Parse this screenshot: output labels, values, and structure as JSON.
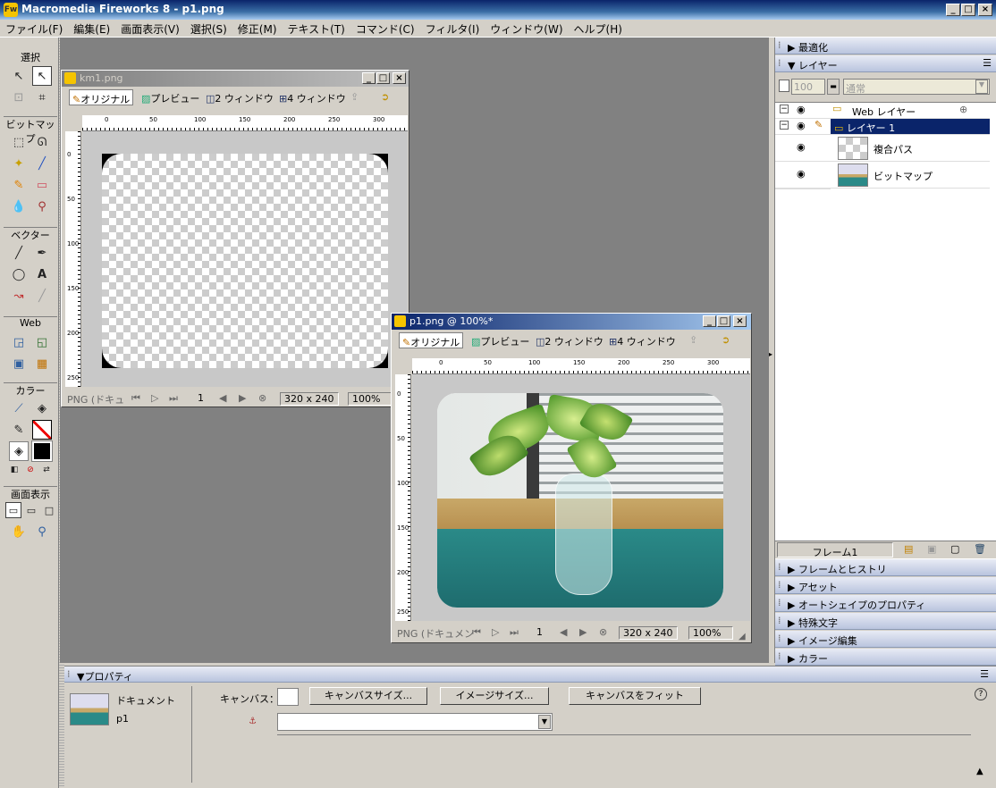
{
  "window": {
    "title": "Macromedia Fireworks 8 - p1.png"
  },
  "menu": [
    "ファイル(F)",
    "編集(E)",
    "画面表示(V)",
    "選択(S)",
    "修正(M)",
    "テキスト(T)",
    "コマンド(C)",
    "フィルタ(I)",
    "ウィンドウ(W)",
    "ヘルプ(H)"
  ],
  "tools": {
    "sections": [
      "選択",
      "ビットマップ",
      "ベクター",
      "Web",
      "カラー",
      "画面表示"
    ]
  },
  "doc1": {
    "title": "km1.png",
    "tabs": [
      "オリジナル",
      "プレビュー",
      "2 ウィンドウ",
      "4 ウィンドウ"
    ],
    "ruler_h": [
      "0",
      "50",
      "100",
      "150",
      "200",
      "250",
      "300"
    ],
    "ruler_v": [
      "0",
      "50",
      "100",
      "150",
      "200",
      "250"
    ],
    "status_type": "PNG (ドキュ",
    "frame": "1",
    "size": "320 x 240",
    "zoom": "100%"
  },
  "doc2": {
    "title": "p1.png @ 100%*",
    "tabs": [
      "オリジナル",
      "プレビュー",
      "2 ウィンドウ",
      "4 ウィンドウ"
    ],
    "ruler_h": [
      "0",
      "50",
      "100",
      "150",
      "200",
      "250",
      "300"
    ],
    "ruler_v": [
      "0",
      "50",
      "100",
      "150",
      "200",
      "250"
    ],
    "status_type": "PNG (ドキュメン",
    "frame": "1",
    "size": "320 x 240",
    "zoom": "100%"
  },
  "panels": {
    "optimize": "最適化",
    "layers": "レイヤー",
    "opacity": "100",
    "blend": "通常",
    "layer_rows": [
      {
        "name": "Web レイヤー"
      },
      {
        "name": "レイヤー 1"
      },
      {
        "name": "複合パス"
      },
      {
        "name": "ビットマップ"
      }
    ],
    "frame_label": "フレーム1",
    "collapsed": [
      "フレームとヒストリ",
      "アセット",
      "オートシェイプのプロパティ",
      "特殊文字",
      "イメージ編集",
      "カラー"
    ]
  },
  "properties": {
    "title": "▼プロパティ",
    "doc_label": "ドキュメント",
    "doc_name": "p1",
    "canvas_label": "キャンバス：",
    "btn_canvas_size": "キャンバスサイズ...",
    "btn_image_size": "イメージサイズ...",
    "btn_fit_canvas": "キャンバスをフィット",
    "help": "?"
  }
}
